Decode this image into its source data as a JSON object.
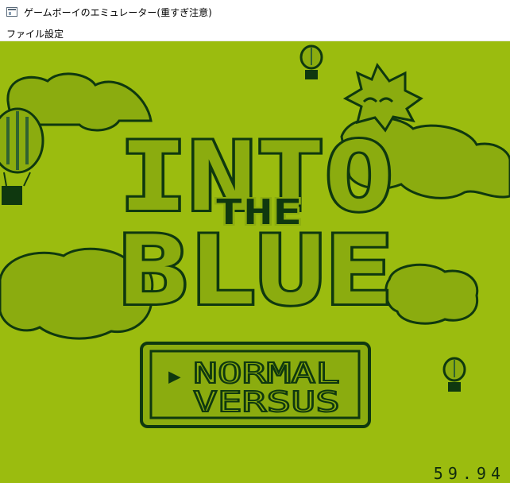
{
  "window": {
    "title": "ゲームボーイのエミュレーター(重すぎ注意)"
  },
  "menu": {
    "file": "ファイル",
    "settings": "設定"
  },
  "game": {
    "title_line1": "INTO",
    "title_the": "THE",
    "title_line2": "BLUE",
    "menu_options": [
      "NORMAL",
      "VERSUS"
    ],
    "cursor": "▶"
  },
  "fps": "59.94",
  "colors": {
    "screen_bg": "#9bbc0f",
    "light": "#8bac0f",
    "dark": "#306230",
    "darkest": "#0f380f"
  }
}
